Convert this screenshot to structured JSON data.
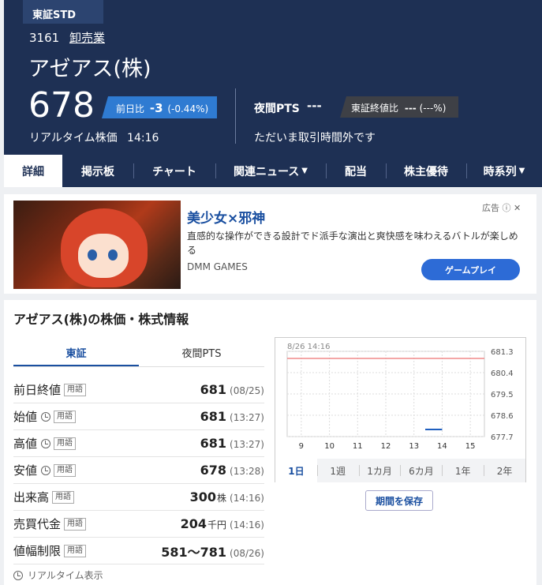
{
  "header": {
    "market_tab": "東証STD",
    "code": "3161",
    "industry": "卸売業",
    "name": "アゼアス(株)",
    "price": "678",
    "change_label": "前日比",
    "change": "-3",
    "change_pct": "(-0.44%)",
    "realtime_label": "リアルタイム株価",
    "time": "14:16",
    "pts_label": "夜間PTS",
    "pts_value": "---",
    "close_label": "東証終値比",
    "close_change": "---",
    "close_pct": "(---%)",
    "pts_status": "ただいま取引時間外です"
  },
  "nav": [
    {
      "label": "詳細"
    },
    {
      "label": "掲示板"
    },
    {
      "label": "チャート"
    },
    {
      "label": "関連ニュース"
    },
    {
      "label": "配当"
    },
    {
      "label": "株主優待"
    },
    {
      "label": "時系列"
    }
  ],
  "ad": {
    "label": "広告",
    "title": "美少女×邪神",
    "description": "直感的な操作ができる設計でド派手な演出と爽快感を味わえるバトルが楽しめる",
    "advertiser": "DMM GAMES",
    "cta": "ゲームプレイ"
  },
  "info": {
    "title": "アゼアス(株)の株価・株式情報",
    "tabs": [
      "東証",
      "夜間PTS"
    ],
    "term_label": "用語",
    "rows": [
      {
        "label": "前日終値",
        "value": "681",
        "unit": "",
        "time": "(08/25)"
      },
      {
        "label": "始値",
        "value": "681",
        "unit": "",
        "time": "(13:27)"
      },
      {
        "label": "高値",
        "value": "681",
        "unit": "",
        "time": "(13:27)"
      },
      {
        "label": "安値",
        "value": "678",
        "unit": "",
        "time": "(13:28)"
      },
      {
        "label": "出来高",
        "value": "300",
        "unit": "株",
        "time": "(14:16)"
      },
      {
        "label": "売買代金",
        "value": "204",
        "unit": "千円",
        "time": "(14:16)"
      },
      {
        "label": "値幅制限",
        "value": "581〜781",
        "unit": "",
        "time": "(08/26)"
      }
    ],
    "realtime_note": "リアルタイム表示",
    "save_period": "期間を保存",
    "period_tabs": [
      "1日",
      "1週",
      "1カ月",
      "6カ月",
      "1年",
      "2年"
    ]
  },
  "chart_data": {
    "type": "line",
    "date_label": "8/26 14:16",
    "x_ticks": [
      "9",
      "10",
      "11",
      "12",
      "13",
      "14",
      "15"
    ],
    "y_ticks": [
      "681.3",
      "680.4",
      "679.5",
      "678.6",
      "677.7"
    ],
    "ylim": [
      677.7,
      681.3
    ],
    "reference_line": {
      "value": 681,
      "color": "#f08a8a"
    },
    "series": [
      {
        "x": [
          13.4,
          14.0
        ],
        "y": [
          678.0,
          678.0
        ],
        "color": "#1f5fbf"
      }
    ],
    "grid": true
  }
}
